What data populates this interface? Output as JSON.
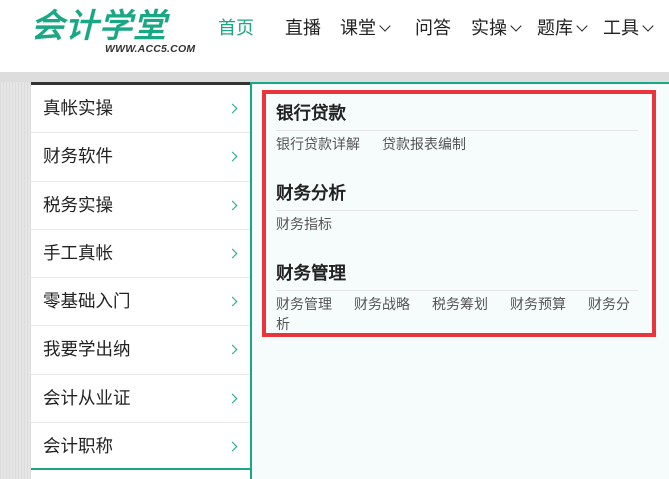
{
  "header": {
    "logo_text": "会计学堂",
    "logo_url": "WWW.ACC5.COM",
    "nav": [
      {
        "label": "首页",
        "active": true,
        "dropdown": false
      },
      {
        "label": "直播",
        "active": false,
        "dropdown": false
      },
      {
        "label": "课堂",
        "active": false,
        "dropdown": true
      },
      {
        "label": "问答",
        "active": false,
        "dropdown": false
      },
      {
        "label": "实操",
        "active": false,
        "dropdown": true
      },
      {
        "label": "题库",
        "active": false,
        "dropdown": true
      },
      {
        "label": "工具",
        "active": false,
        "dropdown": true
      }
    ]
  },
  "sidebar": {
    "items": [
      {
        "label": "真帐实操"
      },
      {
        "label": "财务软件"
      },
      {
        "label": "税务实操"
      },
      {
        "label": "手工真帐"
      },
      {
        "label": "零基础入门"
      },
      {
        "label": "我要学出纳"
      },
      {
        "label": "会计从业证"
      },
      {
        "label": "会计职称"
      }
    ]
  },
  "panel": {
    "sections": [
      {
        "title": "银行贷款",
        "links": [
          "银行贷款详解",
          "贷款报表编制"
        ]
      },
      {
        "title": "财务分析",
        "links": [
          "财务指标"
        ]
      },
      {
        "title": "财务管理",
        "links": [
          "财务管理",
          "财务战略",
          "税务筹划",
          "财务预算",
          "财务分析"
        ]
      }
    ]
  },
  "colors": {
    "brand_green": "#1aa785",
    "highlight_red": "#e8343a",
    "panel_bg": "#f6fbfb"
  }
}
